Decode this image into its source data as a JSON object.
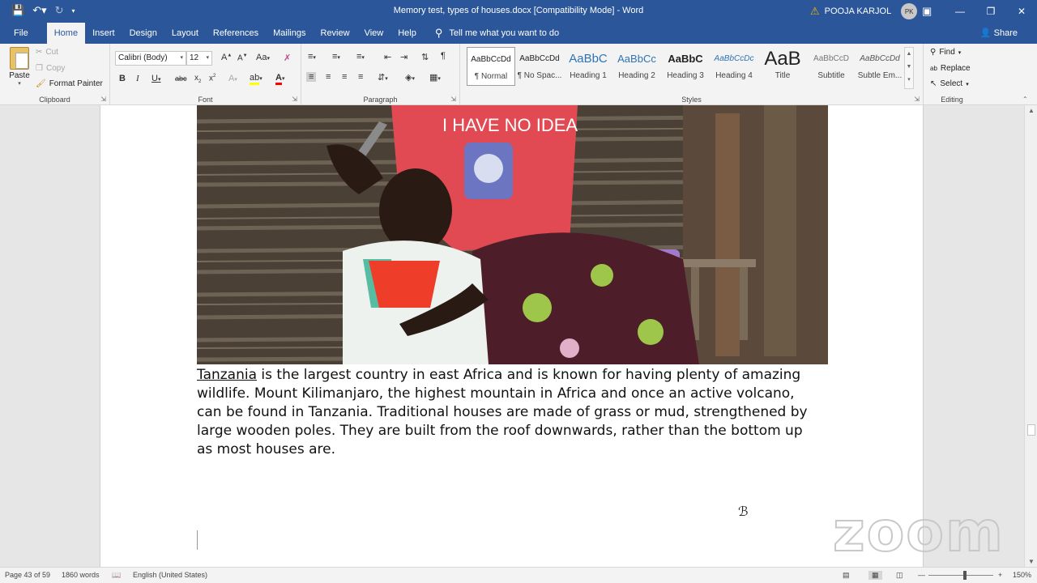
{
  "titlebar": {
    "doc_title": "Memory test, types of houses.docx [Compatibility Mode] - Word",
    "user_name": "POOJA KARJOL",
    "user_initials": "PK"
  },
  "tabs": [
    "File",
    "Home",
    "Insert",
    "Design",
    "Layout",
    "References",
    "Mailings",
    "Review",
    "View",
    "Help"
  ],
  "tellme": "Tell me what you want to do",
  "share": "Share",
  "clipboard": {
    "paste": "Paste",
    "cut": "Cut",
    "copy": "Copy",
    "format_painter": "Format Painter",
    "label": "Clipboard"
  },
  "font": {
    "name": "Calibri (Body)",
    "size": "12",
    "label": "Font"
  },
  "paragraph": {
    "label": "Paragraph"
  },
  "styles": {
    "label": "Styles",
    "items": [
      {
        "sample": "AaBbCcDd",
        "name": "¶ Normal"
      },
      {
        "sample": "AaBbCcDd",
        "name": "¶ No Spac..."
      },
      {
        "sample": "AaBbC",
        "name": "Heading 1"
      },
      {
        "sample": "AaBbCc",
        "name": "Heading 2"
      },
      {
        "sample": "AaBbC",
        "name": "Heading 3"
      },
      {
        "sample": "AaBbCcDc",
        "name": "Heading 4"
      },
      {
        "sample": "AaB",
        "name": "Title"
      },
      {
        "sample": "AaBbCcD",
        "name": "Subtitle"
      },
      {
        "sample": "AaBbCcDd",
        "name": "Subtle Em..."
      }
    ]
  },
  "editing": {
    "find": "Find",
    "replace": "Replace",
    "select": "Select",
    "label": "Editing"
  },
  "document": {
    "link_word": "Tanzania",
    "paragraph_rest": " is the largest country in east Africa and is known for having plenty of amazing wildlife. Mount Kilimanjaro, the highest mountain in Africa and once an active volcano, can be found in Tanzania. Traditional houses are made of grass or mud, strengthened by large wooden poles. They are built from the roof downwards, rather than the bottom up as most houses are.",
    "photo_shirt_text": "I HAVE NO IDEA",
    "watermark": "zoom"
  },
  "statusbar": {
    "page": "Page 43 of 59",
    "words": "1860 words",
    "language": "English (United States)",
    "zoom": "150%"
  },
  "colors": {
    "word_blue": "#2b579a",
    "highlight_yellow": "#ffff00",
    "font_color_red": "#ff0000"
  }
}
